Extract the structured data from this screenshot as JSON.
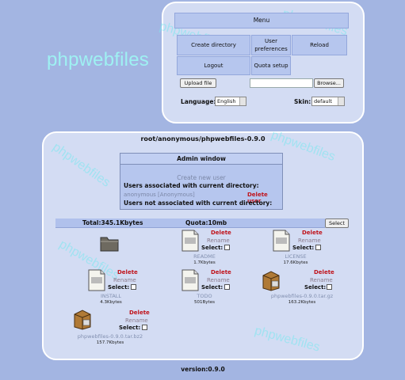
{
  "app": {
    "logo": "phpwebfiles",
    "watermark": "phpwebfiles"
  },
  "menu": {
    "title": "Menu",
    "create_directory": "Create directory",
    "user_preferences": "User preferences",
    "reload": "Reload",
    "logout": "Logout",
    "quota_setup": "Quota setup",
    "upload_file": "Upload file",
    "browse": "Browse...",
    "language_label": "Language:",
    "language_value": "English",
    "skin_label": "Skin:",
    "skin_value": "default"
  },
  "main": {
    "path": "root/anonymous/phpwebfiles-0.9.0",
    "admin": {
      "title": "Admin window",
      "create_user": "Create new user",
      "associated": "Users associated with current directory:",
      "user_row": "anonymous [Anonymous]",
      "delete_user": "Delete user",
      "not_associated": "Users not associated with current directory:"
    },
    "total": "Total:345.1Kbytes",
    "quota": "Quota:10mb",
    "select_button": "Select"
  },
  "files": [
    {
      "name": "",
      "size": "",
      "type": "folder",
      "delete": "",
      "rename": "",
      "select": ""
    },
    {
      "name": "README",
      "size": "1.7Kbytes",
      "type": "doc",
      "delete": "Delete",
      "rename": "Rename",
      "select": "Select:"
    },
    {
      "name": "LICENSE",
      "size": "17.6Kbytes",
      "type": "doc",
      "delete": "Delete",
      "rename": "Rename",
      "select": "Select:"
    },
    {
      "name": "INSTALL",
      "size": "4.3Kbytes",
      "type": "doc",
      "delete": "Delete",
      "rename": "Rename",
      "select": "Select:"
    },
    {
      "name": "TODO",
      "size": "501Bytes",
      "type": "doc",
      "delete": "Delete",
      "rename": "Rename",
      "select": "Select:"
    },
    {
      "name": "phpwebfiles-0.9.0.tar.gz",
      "size": "163.2Kbytes",
      "type": "archive",
      "delete": "Delete",
      "rename": "Rename",
      "select": "Select:"
    },
    {
      "name": "phpwebfiles-0.9.0.tar.bz2",
      "size": "157.7Kbytes",
      "type": "archive",
      "delete": "Delete",
      "rename": "Rename",
      "select": "Select:"
    }
  ],
  "footer": {
    "version": "version:0.9.0"
  },
  "colors": {
    "background": "#a3b5e2",
    "panel": "#d3dcf3",
    "cell": "#b6c6ee",
    "delete": "#c0131b",
    "watermark": "#7ae8f0"
  }
}
